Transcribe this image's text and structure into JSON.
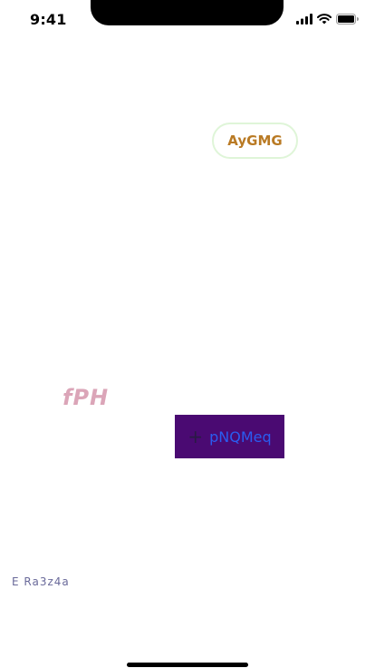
{
  "status_bar": {
    "time": "9:41",
    "icons": [
      "cellular-signal-icon",
      "wifi-icon",
      "battery-icon"
    ]
  },
  "chip": {
    "label": "AyGMG",
    "text_color": "#b97a24",
    "border_color": "#dff5d8"
  },
  "heading": {
    "text": "fPH",
    "color": "#dba5b8"
  },
  "primary_button": {
    "icon": "plus-icon",
    "icon_glyph": "+",
    "label": "pNQMeq",
    "background": "#4a0a72",
    "text_color": "#2a5cf0"
  },
  "footer": {
    "text": "E Ra3z4a",
    "color": "#6a6a9a"
  }
}
